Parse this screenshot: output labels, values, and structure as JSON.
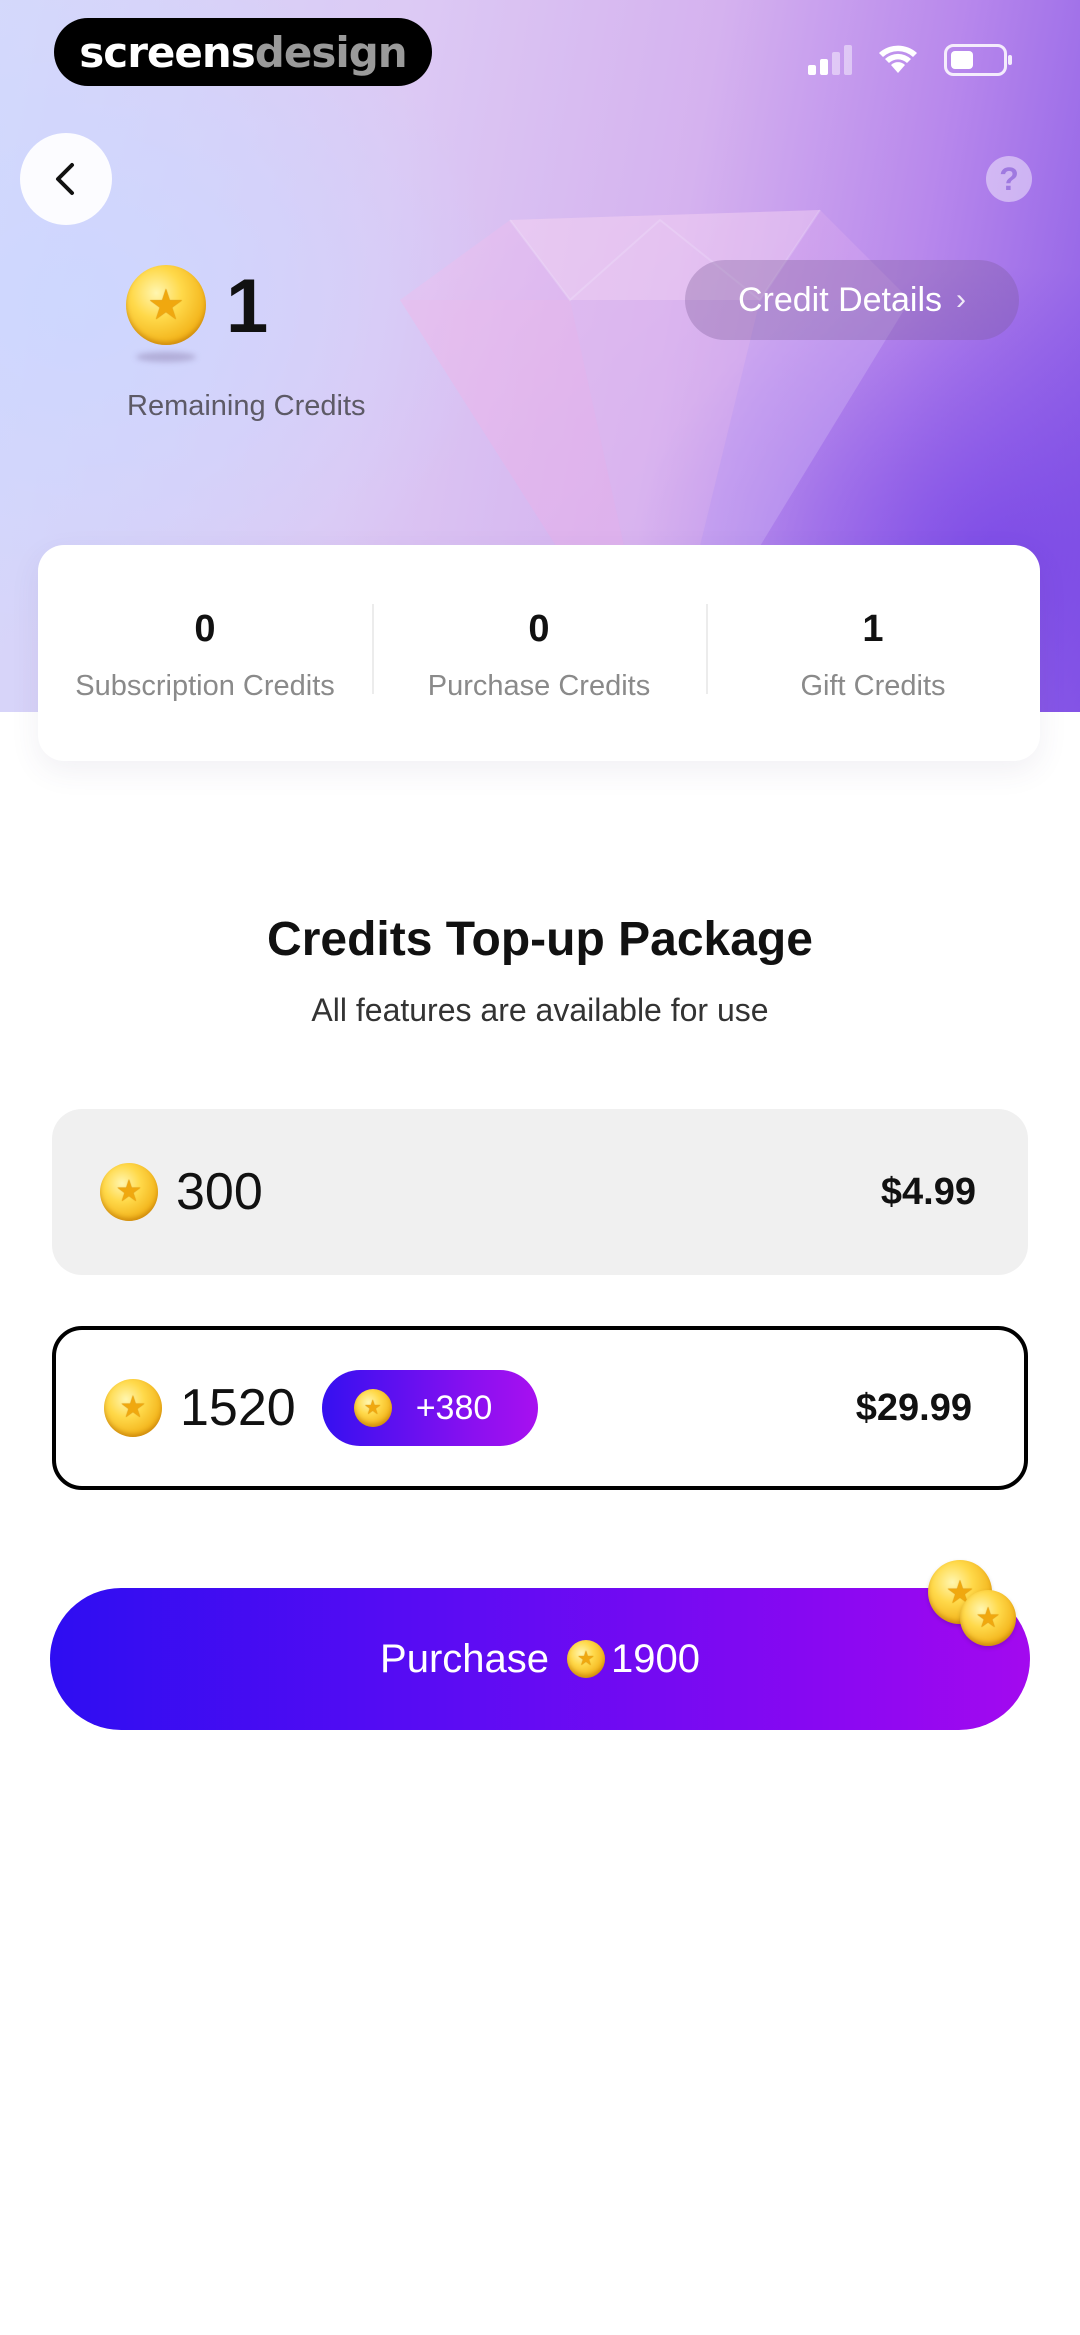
{
  "status_bar": {
    "brand_primary": "screens",
    "brand_secondary": "design",
    "icons": [
      "cellular-signal-icon",
      "wifi-icon",
      "battery-icon"
    ]
  },
  "nav": {
    "back_icon": "chevron-left-icon",
    "help_label": "?"
  },
  "credits": {
    "remaining_count": "1",
    "remaining_label": "Remaining Credits",
    "details_button": "Credit Details",
    "details_chevron": "›"
  },
  "breakdown": [
    {
      "value": "0",
      "label": "Subscription Credits"
    },
    {
      "value": "0",
      "label": "Purchase Credits"
    },
    {
      "value": "1",
      "label": "Gift Credits"
    }
  ],
  "packages": {
    "title": "Credits Top-up Package",
    "subtitle": "All features are available for use",
    "items": [
      {
        "amount": "300",
        "bonus": "",
        "price": "$4.99",
        "selected": false
      },
      {
        "amount": "1520",
        "bonus": "+380",
        "price": "$29.99",
        "selected": true
      }
    ]
  },
  "purchase": {
    "label": "Purchase",
    "total": "1900"
  },
  "colors": {
    "accent_start": "#2e0df2",
    "accent_end": "#a309ef",
    "coin_gold": "#f3b51c",
    "selected_border": "#000000",
    "unselected_bg": "#f0f0f0"
  }
}
